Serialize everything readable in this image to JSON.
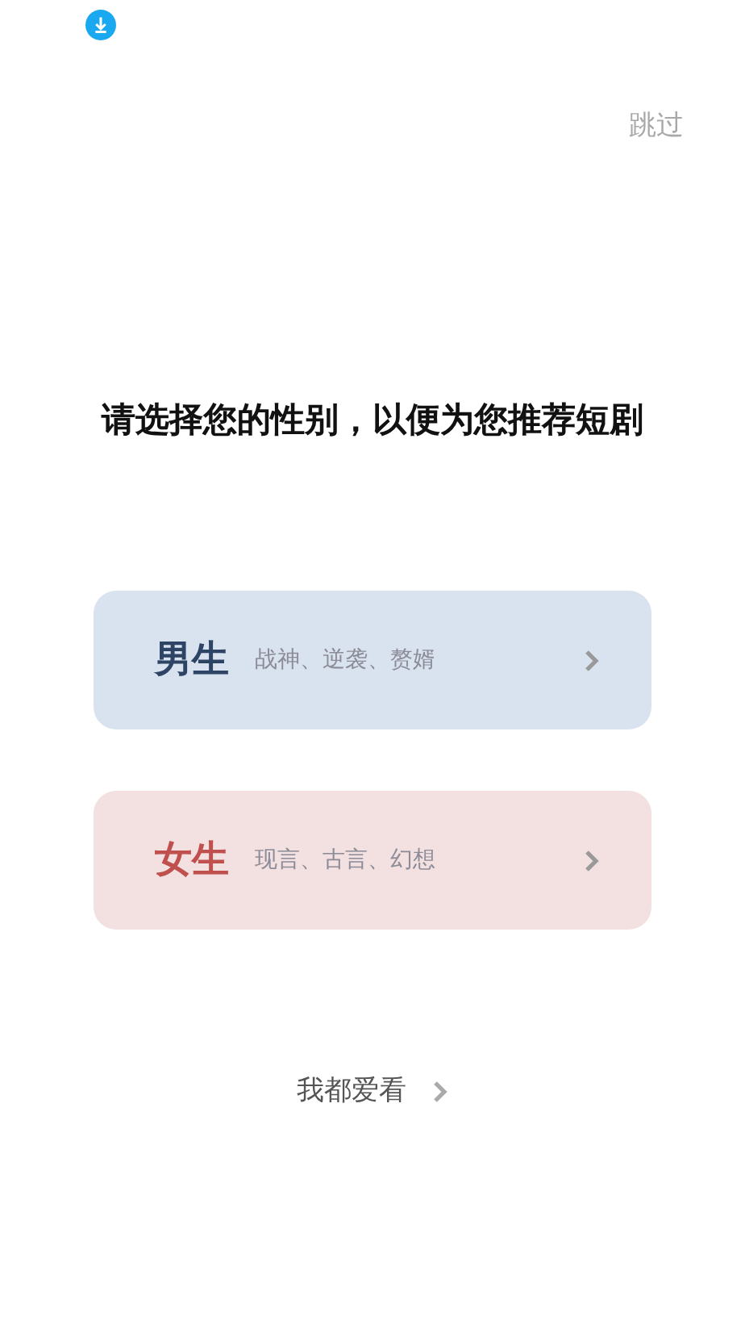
{
  "skip_button": "跳过",
  "title": "请选择您的性别，以便为您推荐短剧",
  "options": [
    {
      "kind": "male",
      "label": "男生",
      "genres": "战神、逆袭、赘婿",
      "color": "#2e4464"
    },
    {
      "kind": "female",
      "label": "女生",
      "genres": "现言、古言、幻想",
      "color": "#c0504d"
    }
  ],
  "all_button": "我都爱看"
}
